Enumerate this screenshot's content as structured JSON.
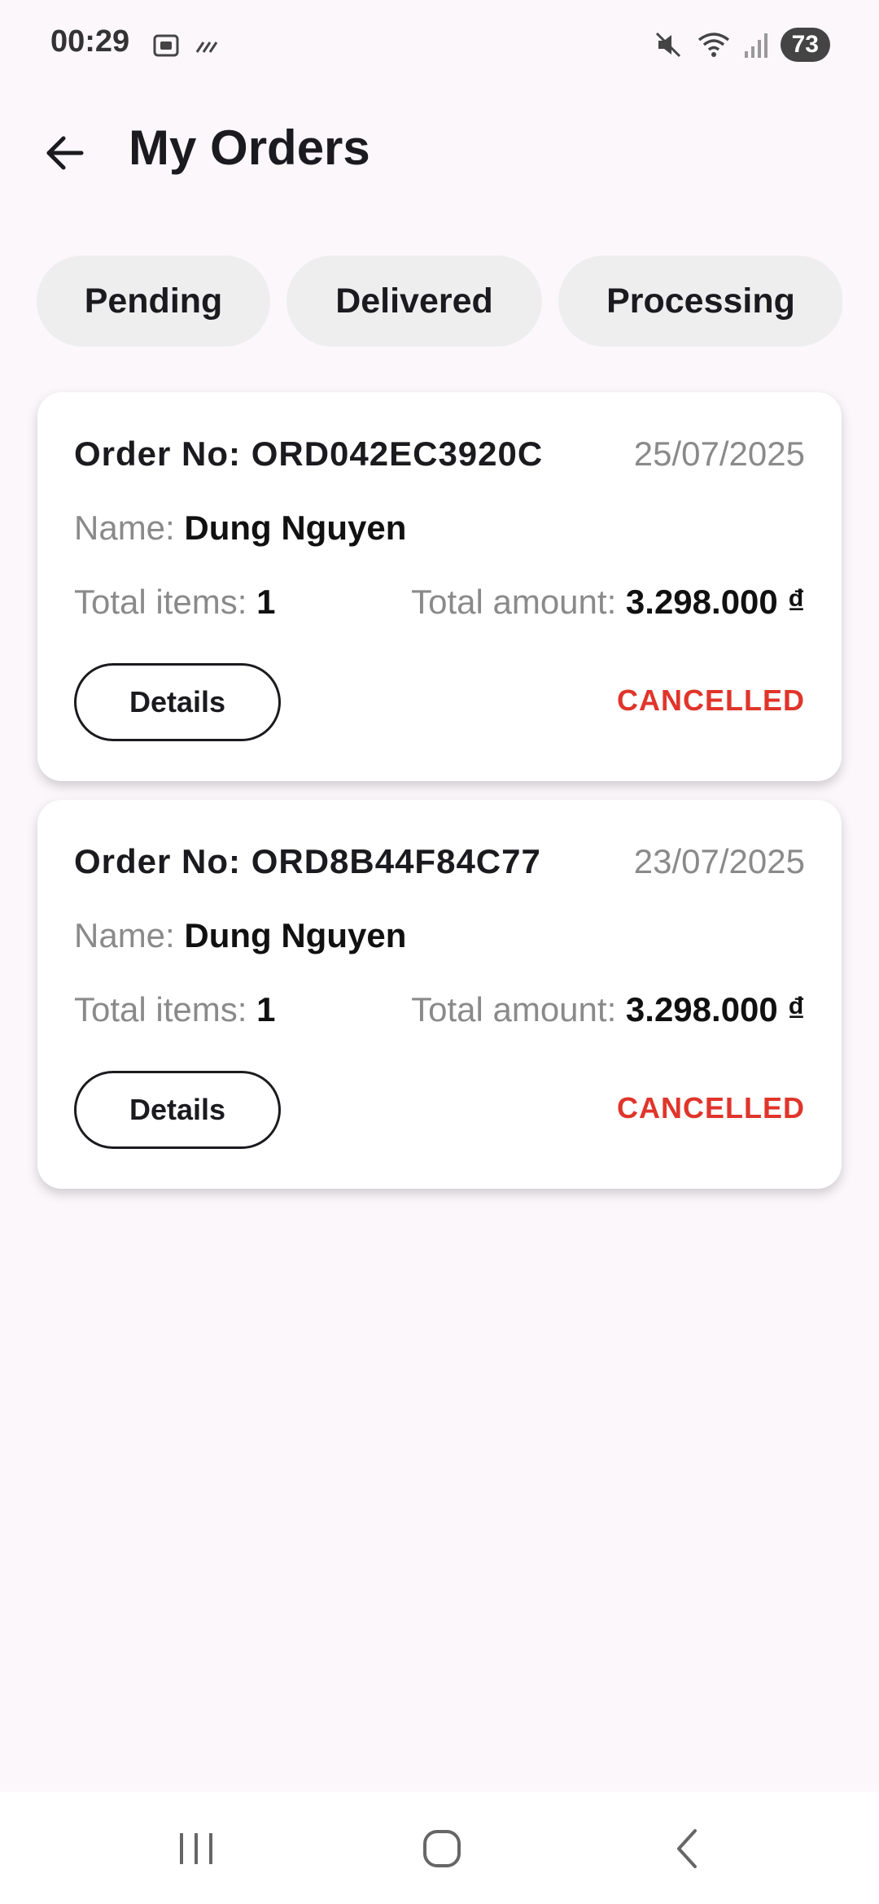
{
  "status_bar": {
    "time": "00:29",
    "battery": "73",
    "icons": [
      "screenshot-icon",
      "signal-data-icon",
      "mute-icon",
      "wifi-icon",
      "cellular-signal-icon",
      "battery-icon"
    ]
  },
  "header": {
    "title": "My Orders",
    "back_icon": "arrow-left-icon"
  },
  "filters": [
    {
      "label": "Pending"
    },
    {
      "label": "Delivered"
    },
    {
      "label": "Processing"
    }
  ],
  "orders": [
    {
      "order_no_label": "Order No:",
      "order_no": "ORD042EC3920C",
      "date": "25/07/2025",
      "name_label": "Name:",
      "name": "Dung Nguyen",
      "items_label": "Total items:",
      "items": "1",
      "amount_label": "Total amount:",
      "amount": "3.298.000 ₫",
      "details_label": "Details",
      "status": "CANCELLED"
    },
    {
      "order_no_label": "Order No:",
      "order_no": "ORD8B44F84C77",
      "date": "23/07/2025",
      "name_label": "Name:",
      "name": "Dung Nguyen",
      "items_label": "Total items:",
      "items": "1",
      "amount_label": "Total amount:",
      "amount": "3.298.000 ₫",
      "details_label": "Details",
      "status": "CANCELLED"
    }
  ],
  "colors": {
    "background": "#fbf7fb",
    "chip": "#efeeef",
    "status_cancelled": "#e0352b",
    "muted_text": "#8a8a8a"
  },
  "nav_bar": {
    "icons": [
      "recents-icon",
      "home-icon",
      "back-icon"
    ]
  }
}
